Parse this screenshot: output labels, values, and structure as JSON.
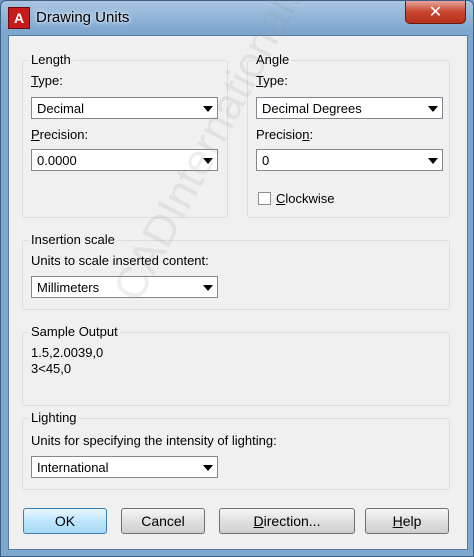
{
  "window": {
    "title": "Drawing Units",
    "app_icon_glyph": "A",
    "close_glyph": "✕"
  },
  "length": {
    "group_title": "Length",
    "type_label_key": "T",
    "type_label_rest": "ype:",
    "type_value": "Decimal",
    "precision_label_key": "P",
    "precision_label_rest": "recision:",
    "precision_value": "0.0000"
  },
  "angle": {
    "group_title": "Angle",
    "type_label_key": "T",
    "type_label_rest": "ype:",
    "type_value": "Decimal Degrees",
    "precision_label_pre": "Precisio",
    "precision_label_key": "n",
    "precision_label_post": ":",
    "precision_value": "0",
    "clockwise_key": "C",
    "clockwise_rest": "lockwise",
    "clockwise_checked": false
  },
  "insertion": {
    "group_title": "Insertion scale",
    "label": "Units to scale inserted content:",
    "value": "Millimeters"
  },
  "sample": {
    "group_title": "Sample Output",
    "line1": "1.5,2.0039,0",
    "line2": "3<45,0"
  },
  "lighting": {
    "group_title": "Lighting",
    "label": "Units for specifying the intensity of lighting:",
    "value": "International"
  },
  "buttons": {
    "ok": "OK",
    "cancel": "Cancel",
    "direction_key": "D",
    "direction_rest": "irection...",
    "help_key": "H",
    "help_rest": "elp"
  },
  "watermark": "CADInternational.com"
}
